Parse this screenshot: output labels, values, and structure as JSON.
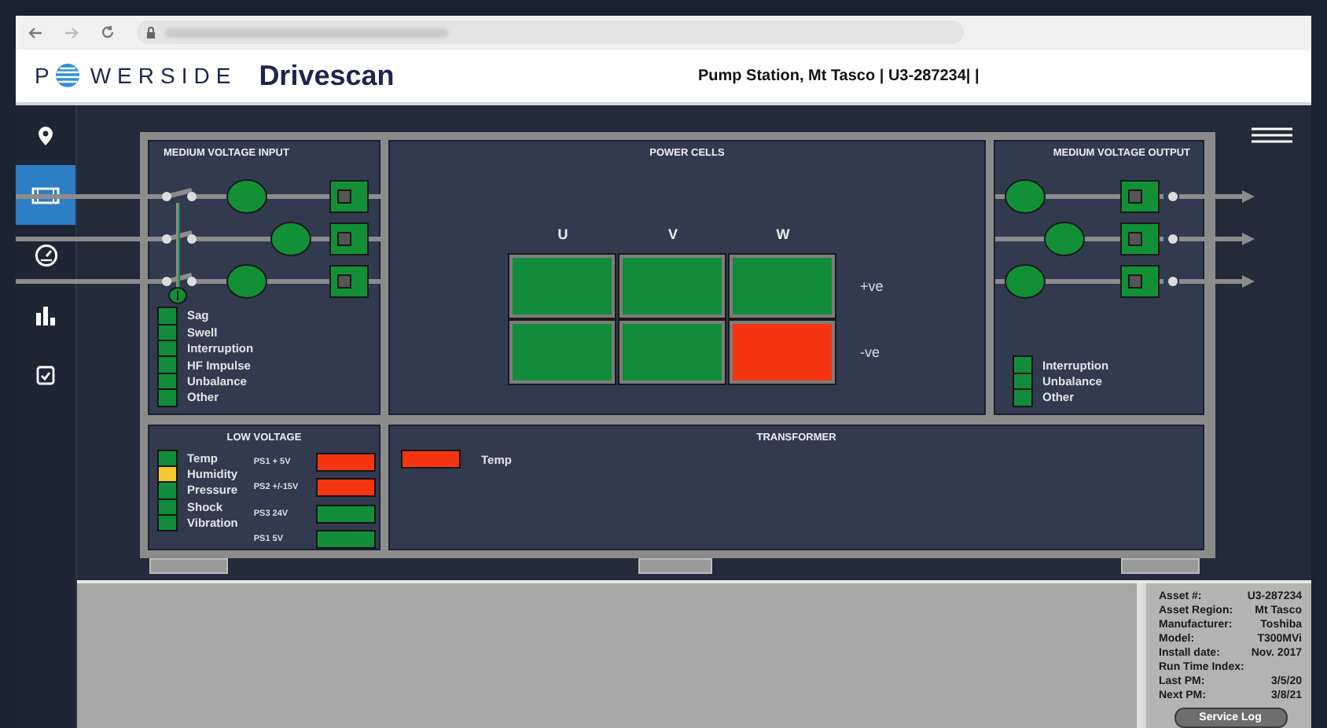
{
  "header": {
    "logo_left": "P",
    "logo_right": "WERSIDE",
    "product": "Drivescan",
    "title": "Pump Station, Mt Tasco | U3-287234| |"
  },
  "sidebar": {
    "items": [
      {
        "kind": "pin",
        "selected": false
      },
      {
        "kind": "drive",
        "selected": true
      },
      {
        "kind": "gauge",
        "selected": false
      },
      {
        "kind": "chart",
        "selected": false
      },
      {
        "kind": "checklist",
        "selected": false
      }
    ]
  },
  "mv_input": {
    "title": "MEDIUM VOLTAGE INPUT",
    "indicators": [
      {
        "label": "Sag",
        "color": "#118c3a"
      },
      {
        "label": "Swell",
        "color": "#118c3a"
      },
      {
        "label": "Interruption",
        "color": "#118c3a"
      },
      {
        "label": "HF Impulse",
        "color": "#118c3a"
      },
      {
        "label": "Unbalance",
        "color": "#118c3a"
      },
      {
        "label": "Other",
        "color": "#118c3a"
      }
    ]
  },
  "power_cells": {
    "title": "POWER CELLS",
    "columns": [
      "U",
      "V",
      "W"
    ],
    "rows": [
      {
        "label": "+ve",
        "cells": [
          {
            "color": "#118c3a"
          },
          {
            "color": "#118c3a"
          },
          {
            "color": "#118c3a"
          }
        ]
      },
      {
        "label": "-ve",
        "cells": [
          {
            "color": "#118c3a"
          },
          {
            "color": "#118c3a"
          },
          {
            "color": "#f53512"
          }
        ]
      }
    ]
  },
  "mv_output": {
    "title": "MEDIUM VOLTAGE OUTPUT",
    "indicators": [
      {
        "label": "Interruption",
        "color": "#118c3a"
      },
      {
        "label": "Unbalance",
        "color": "#118c3a"
      },
      {
        "label": "Other",
        "color": "#118c3a"
      }
    ]
  },
  "low_voltage": {
    "title": "LOW VOLTAGE",
    "indicators": [
      {
        "label": "Temp",
        "color": "#118c3a"
      },
      {
        "label": "Humidity",
        "color": "#f7c930"
      },
      {
        "label": "Pressure",
        "color": "#118c3a"
      },
      {
        "label": "Shock",
        "color": "#118c3a"
      },
      {
        "label": "Vibration",
        "color": "#118c3a"
      }
    ],
    "supplies": [
      {
        "label": "PS1 + 5V",
        "color": "#f53512"
      },
      {
        "label": "PS2 +/-15V",
        "color": "#f53512"
      },
      {
        "label": "PS3 24V",
        "color": "#118c3a"
      },
      {
        "label": "PS1 5V",
        "color": "#118c3a"
      }
    ]
  },
  "transformer": {
    "title": "TRANSFORMER",
    "indicators": [
      {
        "label": "Temp",
        "color": "#f53512"
      }
    ]
  },
  "asset": {
    "fields": [
      {
        "label": "Asset #:",
        "value": "U3-287234"
      },
      {
        "label": "Asset Region:",
        "value": "Mt Tasco"
      },
      {
        "label": "Manufacturer:",
        "value": "Toshiba"
      },
      {
        "label": "Model:",
        "value": "T300MVi"
      },
      {
        "label": "Install date:",
        "value": "Nov. 2017"
      },
      {
        "label": "Run Time Index:"
      },
      {
        "label": "Last PM:",
        "value": "3/5/20"
      },
      {
        "label": "Next PM:",
        "value": "3/8/21"
      }
    ],
    "button": "Service Log"
  }
}
